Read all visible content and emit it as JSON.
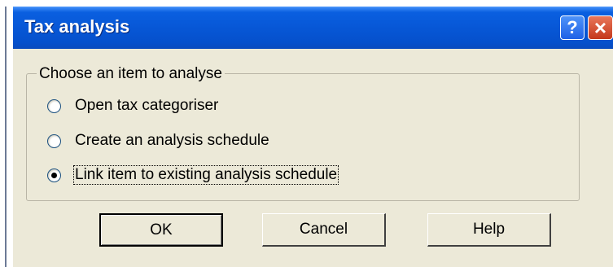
{
  "window": {
    "title": "Tax analysis",
    "help_glyph": "?",
    "close_glyph": "×"
  },
  "group": {
    "legend": "Choose an item to analyse",
    "options": [
      {
        "label": "Open tax categoriser",
        "checked": false
      },
      {
        "label": "Create an analysis schedule",
        "checked": false
      },
      {
        "label": "Link item to existing analysis schedule",
        "checked": true
      }
    ]
  },
  "buttons": {
    "ok": "OK",
    "cancel": "Cancel",
    "help": "Help"
  },
  "colors": {
    "titlebar": "#0757d6",
    "dialog_bg": "#ece9d8",
    "close_button": "#c4381b"
  },
  "icons": {
    "help": "help-icon",
    "close": "close-icon"
  }
}
